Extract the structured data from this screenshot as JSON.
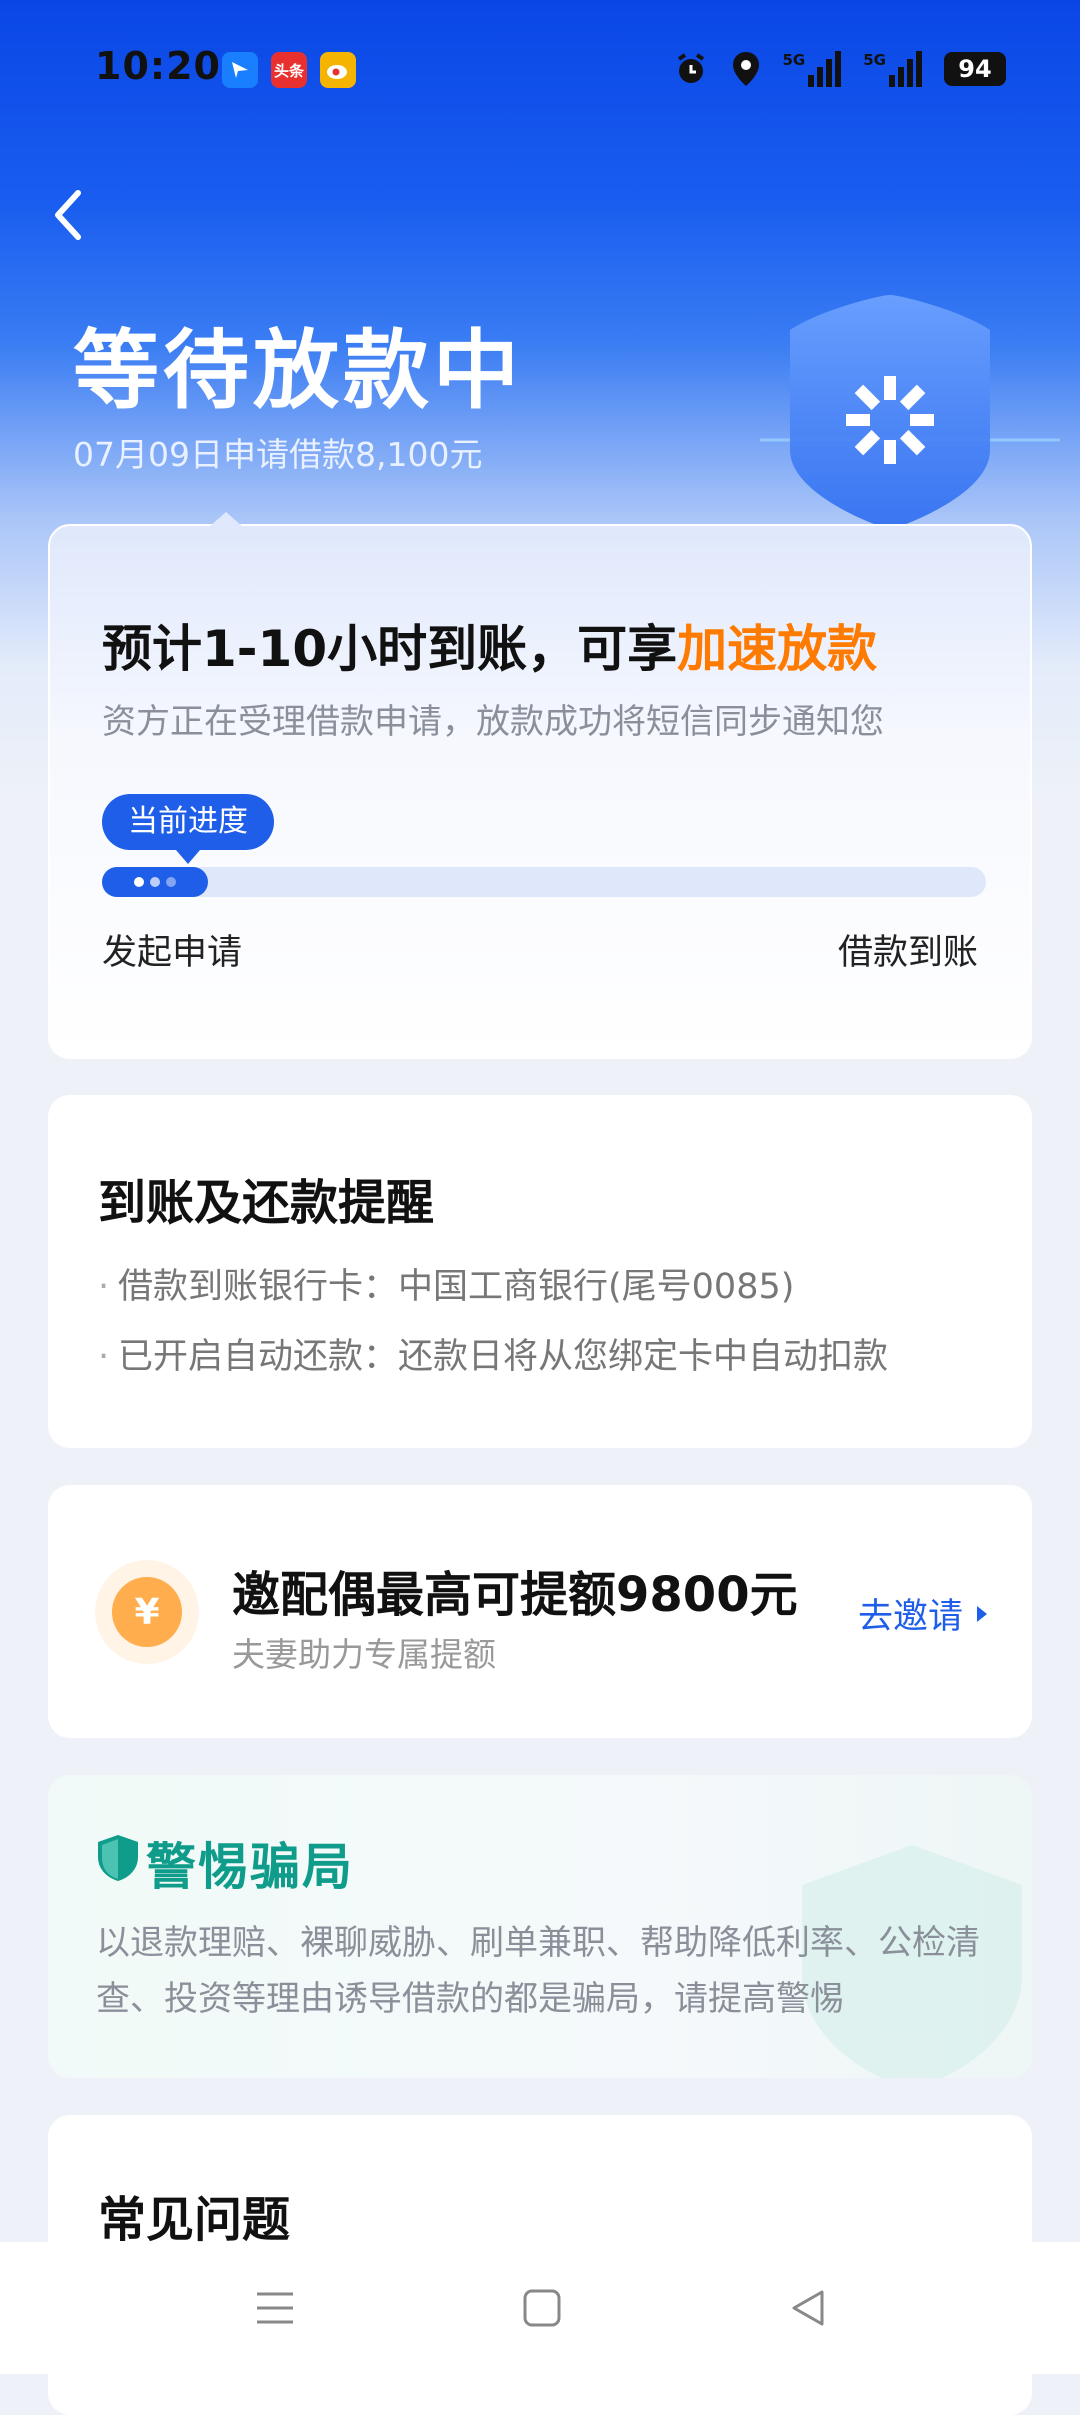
{
  "status_bar": {
    "time": "10:20",
    "apps": [
      {
        "name": "feishu-icon",
        "label": "",
        "color": "#1a7fff"
      },
      {
        "name": "toutiao-icon",
        "label": "头条",
        "color": "#e8312f"
      },
      {
        "name": "weibo-icon",
        "label": "",
        "color": "#f5b400"
      }
    ],
    "sim1_label": "5G",
    "sim2_label": "5G",
    "battery": "94"
  },
  "header": {
    "title": "等待放款中",
    "subtitle": "07月09日申请借款8,100元"
  },
  "progress_card": {
    "headline_prefix": "预计1-10小时到账，可享",
    "headline_accent": "加速放款",
    "description": "资方正在受理借款申请，放款成功将短信同步通知您",
    "badge": "当前进度",
    "progress_fraction": 0.12,
    "start_label": "发起申请",
    "end_label": "借款到账"
  },
  "reminder_card": {
    "title": "到账及还款提醒",
    "items": [
      "借款到账银行卡：中国工商银行(尾号0085)",
      "已开启自动还款：还款日将从您绑定卡中自动扣款"
    ]
  },
  "invite_card": {
    "coin_symbol": "¥",
    "title": "邀配偶最高可提额9800元",
    "subtitle": "夫妻助力专属提额",
    "link": "去邀请"
  },
  "warning_card": {
    "title": "警惕骗局",
    "text": "以退款理赔、裸聊威胁、刷单兼职、帮助降低利率、公检清查、投资等理由诱导借款的都是骗局，请提高警惕"
  },
  "faq_card": {
    "title": "常见问题"
  },
  "colors": {
    "brand_blue": "#1f5ee8",
    "accent_orange": "#ff7a00",
    "warning_green": "#0f9c8a"
  }
}
